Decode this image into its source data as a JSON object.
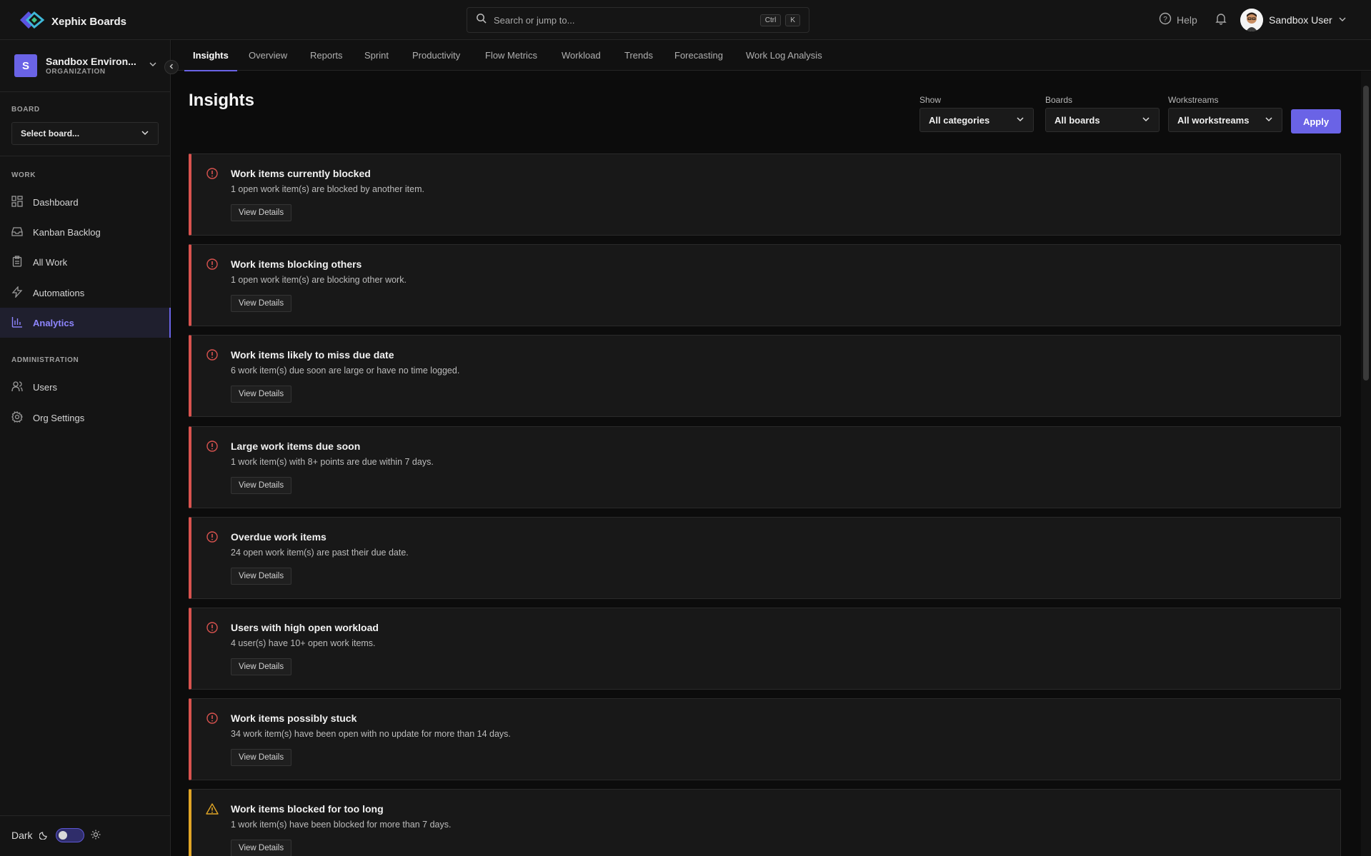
{
  "brand": {
    "name": "Xephix Boards",
    "color": "#6a63e6"
  },
  "search": {
    "placeholder": "Search or jump to...",
    "kbd_ctrl": "Ctrl",
    "kbd_key": "K"
  },
  "header": {
    "help": "Help",
    "user_name": "Sandbox User"
  },
  "org": {
    "initial": "S",
    "name": "Sandbox Environ...",
    "type": "ORGANIZATION"
  },
  "sidebar": {
    "board_label": "BOARD",
    "board_select": "Select board...",
    "work_label": "WORK",
    "work_items": [
      {
        "label": "Dashboard",
        "icon": "dashboard-icon"
      },
      {
        "label": "Kanban Backlog",
        "icon": "inbox-icon"
      },
      {
        "label": "All Work",
        "icon": "clipboard-icon"
      },
      {
        "label": "Automations",
        "icon": "lightning-icon"
      },
      {
        "label": "Analytics",
        "icon": "chart-icon"
      }
    ],
    "admin_label": "ADMINISTRATION",
    "admin_items": [
      {
        "label": "Users",
        "icon": "users-icon"
      },
      {
        "label": "Org Settings",
        "icon": "gear-icon"
      }
    ],
    "theme_label": "Dark"
  },
  "tabs": [
    "Insights",
    "Overview",
    "Reports",
    "Sprint",
    "Productivity",
    "Flow Metrics",
    "Workload",
    "Trends",
    "Forecasting",
    "Work Log Analysis"
  ],
  "main": {
    "title": "Insights",
    "filters": {
      "show_label": "Show",
      "show_value": "All categories",
      "boards_label": "Boards",
      "boards_value": "All boards",
      "workstreams_label": "Workstreams",
      "workstreams_value": "All workstreams",
      "apply": "Apply"
    },
    "view_details": "View Details",
    "insights": [
      {
        "title": "Work items currently blocked",
        "desc": "1 open work item(s) are blocked by another item.",
        "severity": "critical"
      },
      {
        "title": "Work items blocking others",
        "desc": "1 open work item(s) are blocking other work.",
        "severity": "critical"
      },
      {
        "title": "Work items likely to miss due date",
        "desc": "6 work item(s) due soon are large or have no time logged.",
        "severity": "critical"
      },
      {
        "title": "Large work items due soon",
        "desc": "1 work item(s) with 8+ points are due within 7 days.",
        "severity": "critical"
      },
      {
        "title": "Overdue work items",
        "desc": "24 open work item(s) are past their due date.",
        "severity": "critical"
      },
      {
        "title": "Users with high open workload",
        "desc": "4 user(s) have 10+ open work items.",
        "severity": "critical"
      },
      {
        "title": "Work items possibly stuck",
        "desc": "34 work item(s) have been open with no update for more than 14 days.",
        "severity": "critical"
      },
      {
        "title": "Work items blocked for too long",
        "desc": "1 work item(s) have been blocked for more than 7 days.",
        "severity": "warning"
      }
    ]
  },
  "colors": {
    "critical": "#d9534f",
    "warning": "#e0a526",
    "accent": "#6a63e6"
  }
}
